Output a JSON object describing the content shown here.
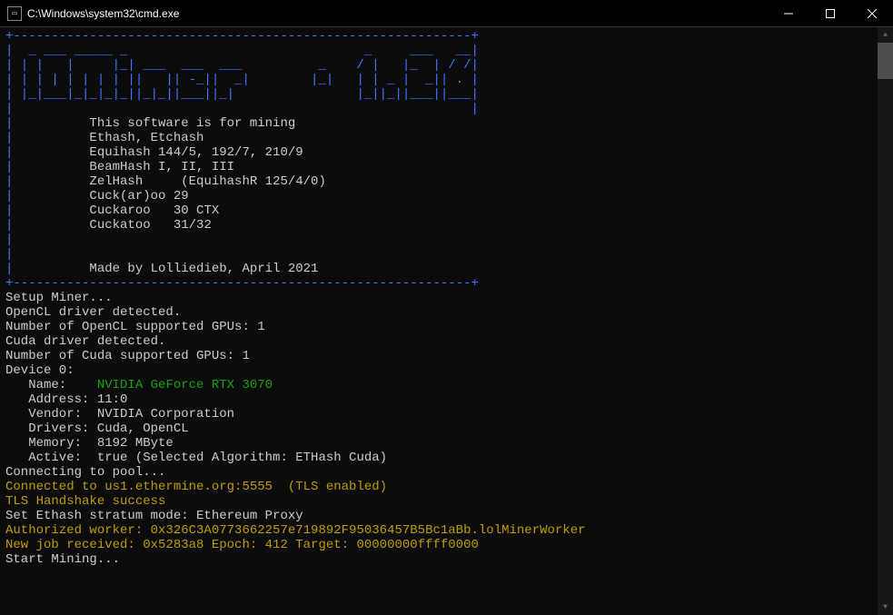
{
  "window": {
    "title": "C:\\Windows\\system32\\cmd.exe",
    "icon_label": "cmd"
  },
  "ascii_art": {
    "line1": "+------------------------------------------------------------+",
    "line2": "|  _ ___ _____ _                               _     ___   __|",
    "line3": "| | |   |     |_| ___  ___  ___          _    / |   |_  | / /|",
    "line4": "| | | | | | | | ||   || -_||  _|        |_|   | | _ |  _|| . |",
    "line5": "| |_|___|_|_|_|_||_|_||___||_|                |_||_||___||___|",
    "line6": "|                                                            |"
  },
  "intro": {
    "l1": "          This software is for mining",
    "l2": "          Ethash, Etchash",
    "l3": "          Equihash 144/5, 192/7, 210/9",
    "l4": "          BeamHash I, II, III",
    "l5": "          ZelHash     (EquihashR 125/4/0)",
    "l6": "          Cuck(ar)oo 29",
    "l7": "          Cuckaroo   30 CTX",
    "l8": "          Cuckatoo   31/32",
    "blank": "",
    "footer": "          Made by Lolliedieb, April 2021",
    "dashline": "+------------------------------------------------------------+"
  },
  "setup": {
    "l1": "Setup Miner...",
    "l2": "OpenCL driver detected.",
    "l3": "Number of OpenCL supported GPUs: 1",
    "l4": "Cuda driver detected.",
    "l5": "Number of Cuda supported GPUs: 1",
    "l6": "Device 0:",
    "name_label": "   Name:    ",
    "name_value": "NVIDIA GeForce RTX 3070",
    "address": "   Address: 11:0",
    "vendor": "   Vendor:  NVIDIA Corporation",
    "drivers": "   Drivers: Cuda, OpenCL",
    "memory": "   Memory:  8192 MByte",
    "active": "   Active:  true (Selected Algorithm: ETHash Cuda)"
  },
  "pool": {
    "connecting": "Connecting to pool...",
    "connected": "Connected to us1.ethermine.org:5555  (TLS enabled)",
    "tls": "TLS Handshake success",
    "stratum": "Set Ethash stratum mode: Ethereum Proxy",
    "authorized": "Authorized worker: 0x326C3A0773662257e719892F95036457B5Bc1aBb.lolMinerWorker",
    "newjob": "New job received: 0x5283a8 Epoch: 412 Target: 00000000ffff0000",
    "start": "Start Mining..."
  }
}
